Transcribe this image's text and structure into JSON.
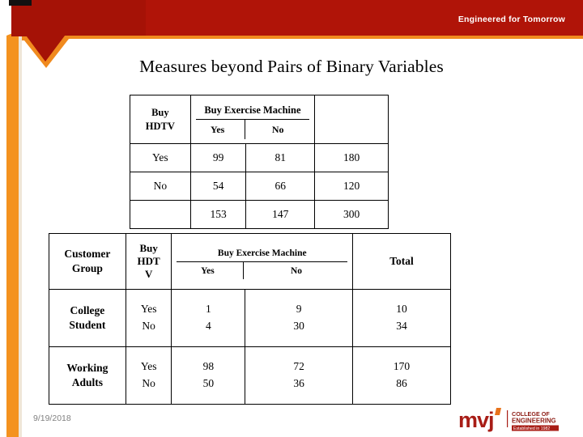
{
  "branding": {
    "tagline": "Engineered for Tomorrow",
    "banner_red": "#b01408",
    "accent_orange": "#f08a1e",
    "logo": {
      "wordmark": "mvj",
      "line1": "COLLEGE OF",
      "line2": "ENGINEERING",
      "line3": "Established in 1982",
      "mark_red": "#a81d16",
      "mark_orange": "#e8731c"
    }
  },
  "slide": {
    "title": "Measures beyond Pairs of Binary Variables",
    "date": "9/19/2018"
  },
  "table_one": {
    "row_header_line1": "Buy",
    "row_header_line2": "HDTV",
    "group_header": "Buy Exercise Machine",
    "sub_yes": "Yes",
    "sub_no": "No",
    "corner_blank": "",
    "rows": [
      {
        "label": "Yes",
        "yes": "99",
        "no": "81",
        "total": "180"
      },
      {
        "label": "No",
        "yes": "54",
        "no": "66",
        "total": "120"
      },
      {
        "label": "",
        "yes": "153",
        "no": "147",
        "total": "300"
      }
    ]
  },
  "table_two": {
    "col_customer_group_line1": "Customer",
    "col_customer_group_line2": "Group",
    "col_hdtv_line1": "Buy",
    "col_hdtv_line2": "HDT",
    "col_hdtv_line3": "V",
    "group_header": "Buy Exercise Machine",
    "sub_yes": "Yes",
    "sub_no": "No",
    "col_total": "Total",
    "rows": [
      {
        "group_line1": "College",
        "group_line2": "Student",
        "hdtv_line1": "Yes",
        "hdtv_line2": "No",
        "yes_line1": "1",
        "yes_line2": "4",
        "no_line1": "9",
        "no_line2": "30",
        "total_line1": "10",
        "total_line2": "34"
      },
      {
        "group_line1": "Working",
        "group_line2": "Adults",
        "hdtv_line1": "Yes",
        "hdtv_line2": "No",
        "yes_line1": "98",
        "yes_line2": "50",
        "no_line1": "72",
        "no_line2": "36",
        "total_line1": "170",
        "total_line2": "86"
      }
    ]
  }
}
